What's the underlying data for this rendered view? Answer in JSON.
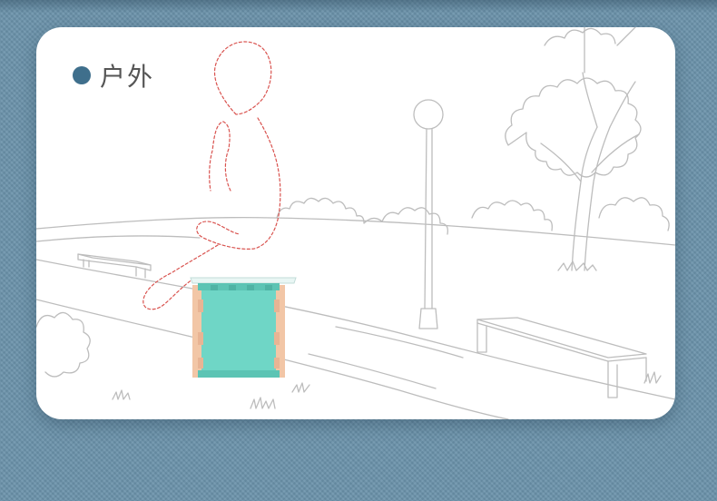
{
  "card": {
    "title": "户外"
  },
  "colors": {
    "background": "#6b93ab",
    "title_dot": "#3f6f8c",
    "stool_body": "#6fd6c6",
    "stool_accent": "#f2c6a6",
    "figure_outline": "#d9534f",
    "sketch_line": "#bdbdbd"
  },
  "icons": [
    "bullet-dot-icon"
  ]
}
